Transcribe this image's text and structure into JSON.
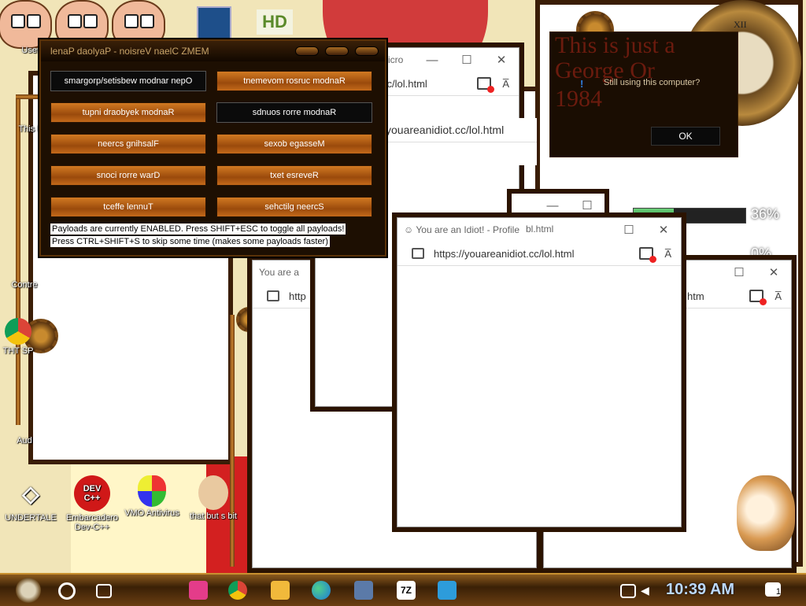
{
  "desktop": {
    "icons": [
      {
        "label": "User"
      },
      {
        "label": "This P"
      },
      {
        "label": "Contre"
      },
      {
        "label": "THT SP"
      },
      {
        "label": "Aud"
      },
      {
        "label": "UNDERTALE"
      },
      {
        "label": "Embarcadero Dev-C++",
        "glyph": "DEV C++"
      },
      {
        "label": "VMO Antivirus"
      },
      {
        "label": "that but s bit"
      }
    ],
    "app_logo": "HD"
  },
  "memz": {
    "title": "lenaP daolyaP - noisreV naelC ZMEM",
    "buttons": [
      {
        "label": "smargorp/setisbew modnar nepO",
        "active": true
      },
      {
        "label": "tnemevom rosruc modnaR",
        "active": false
      },
      {
        "label": "tupni draobyek modnaR",
        "active": false
      },
      {
        "label": "sdnuos rorre modnaR",
        "active": true
      },
      {
        "label": "neercs gnihsalF",
        "active": false
      },
      {
        "label": "sexob egasseM",
        "active": false
      },
      {
        "label": "snoci rorre warD",
        "active": false
      },
      {
        "label": "txet esreveR",
        "active": false
      },
      {
        "label": "tceffe lennuT",
        "active": false
      },
      {
        "label": "sehctilg neercS",
        "active": false
      }
    ],
    "note1": "Payloads are currently ENABLED. Press SHIFT+ESC to toggle all payloads!",
    "note2": "Press CTRL+SHIFT+S to skip some time (makes some payloads faster)"
  },
  "browser": {
    "title_partial": "Micro",
    "tab_title": "You are an Idiot! - Profile",
    "tab_title_short": "You are a",
    "url": "https://youareanidiot.cc/lol.html",
    "url_frag": "cc/lol.html",
    "url_mid": "youareanidiot.cc/lol.html",
    "url_frag2": "bl.html",
    "url_frag3": "http",
    "url_frag4": "htm",
    "aa": "A̅",
    "minimize": "—",
    "maximize": "☐",
    "close": "✕"
  },
  "msgbox": {
    "bg_line1": "This is just a",
    "bg_line2": "George Or",
    "bg_line3": "1984",
    "info_icon": "!",
    "message": "Still using this computer?",
    "ok": "OK"
  },
  "meters": [
    {
      "text": "36%",
      "value": 0.36
    },
    {
      "text": "0%",
      "value": 0.0
    }
  ],
  "taskbar": {
    "time": "10:39 AM",
    "notif_count": "1",
    "zip_label": "7Z"
  }
}
